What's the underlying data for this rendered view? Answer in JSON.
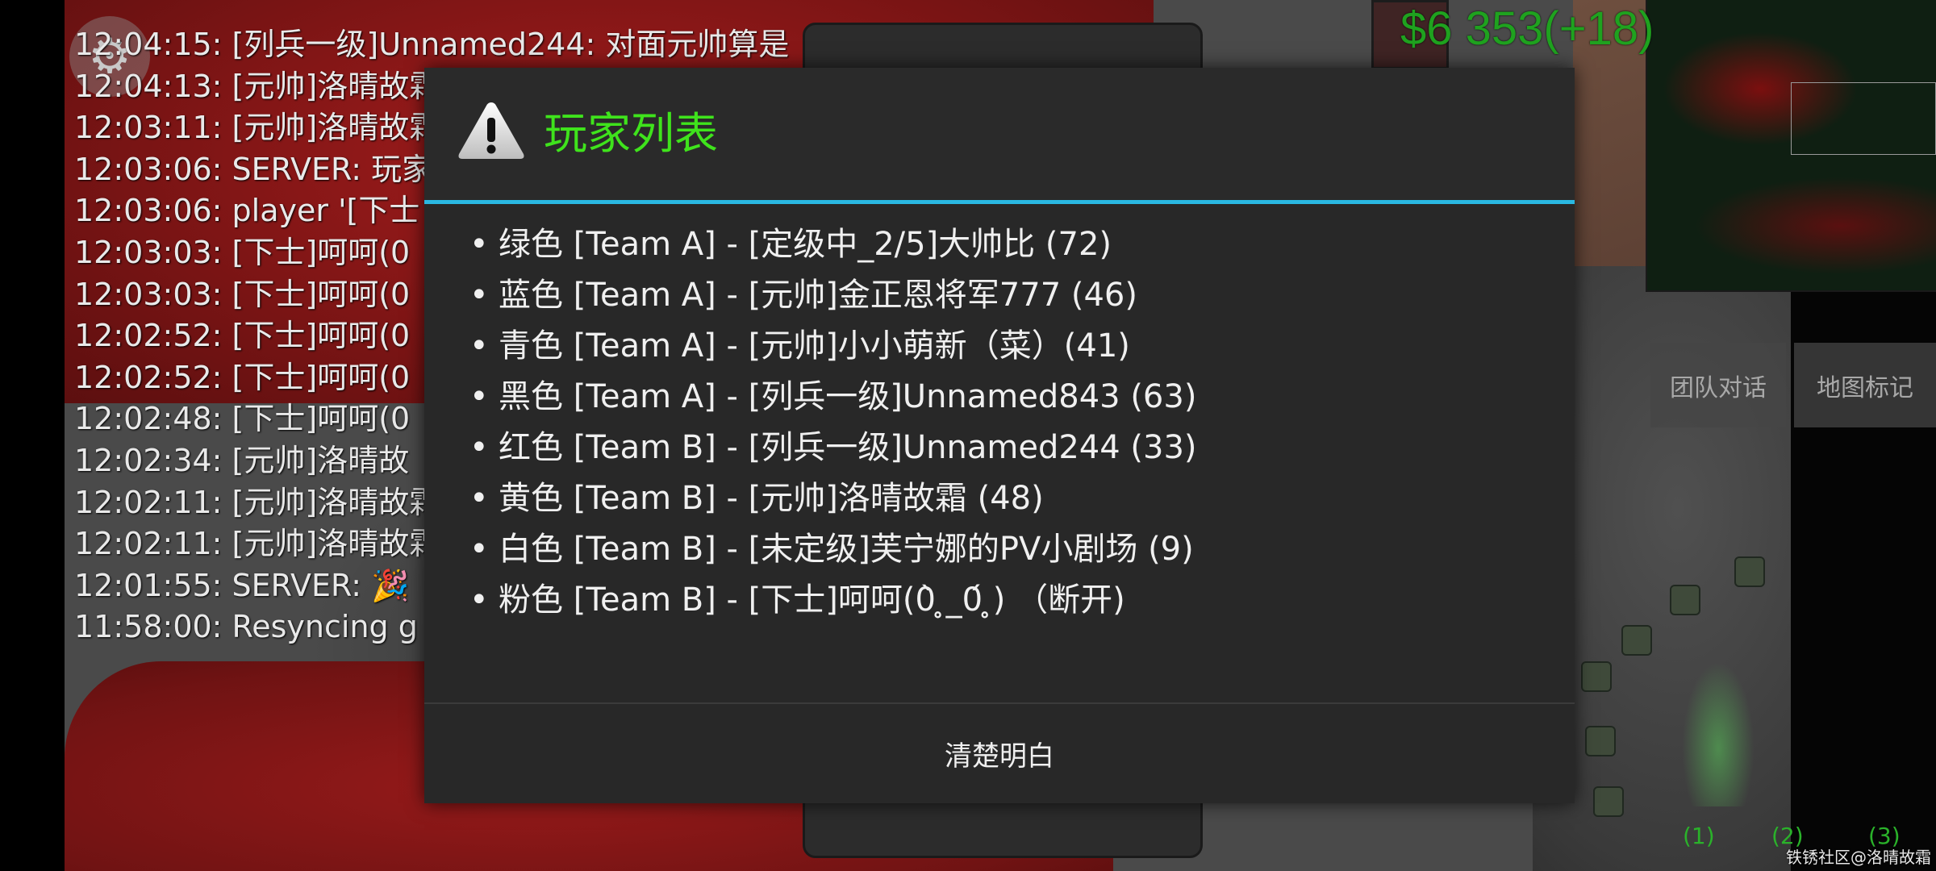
{
  "hud": {
    "money": "$6 353(+18)",
    "team_chat_button": "团队对话",
    "map_marker_button": "地图标记",
    "control_groups": [
      "(1)",
      "(2)",
      "(3)"
    ],
    "watermark": "铁锈社区@洛晴故霜",
    "settings_icon": "gear-icon"
  },
  "chat_log": [
    "12:04:15: [列兵一级]Unnamed244: 对面元帅算是",
    "12:04:13: [元帅]洛晴故霜",
    "12:03:11: [元帅]洛晴故霜",
    "12:03:06: SERVER: 玩家",
    "12:03:06: player '[下士",
    "12:03:03: [下士]呵呵(0",
    "12:03:03: [下士]呵呵(0",
    "12:02:52: [下士]呵呵(0",
    "12:02:52: [下士]呵呵(0",
    "12:02:48: [下士]呵呵(0",
    "12:02:34: [元帅]洛晴故",
    "12:02:11: [元帅]洛晴故霜",
    "12:02:11: [元帅]洛晴故霜",
    "12:01:55: SERVER: 🎉",
    "11:58:00: Resyncing g"
  ],
  "dialog": {
    "icon": "warning-icon",
    "title": "玩家列表",
    "title_color": "#3fe31c",
    "accent_color": "#2ab8e2",
    "players": [
      "绿色 [Team A] - [定级中_2/5]大帅比 (72)",
      "蓝色 [Team A] - [元帅]金正恩将军777 (46)",
      "青色 [Team A] - [元帅]小小萌新（菜）(41)",
      "黑色 [Team A] - [列兵一级]Unnamed843 (63)",
      "红色 [Team B] - [列兵一级]Unnamed244 (33)",
      "黄色 [Team B] - [元帅]洛晴故霜 (48)",
      "白色 [Team B] - [未定级]芙宁娜的PV小剧场 (9)",
      "粉色 [Team B] - [下士]呵呵(0̀ ̥_0́ ̥) （断开)"
    ],
    "confirm_label": "清楚明白"
  }
}
